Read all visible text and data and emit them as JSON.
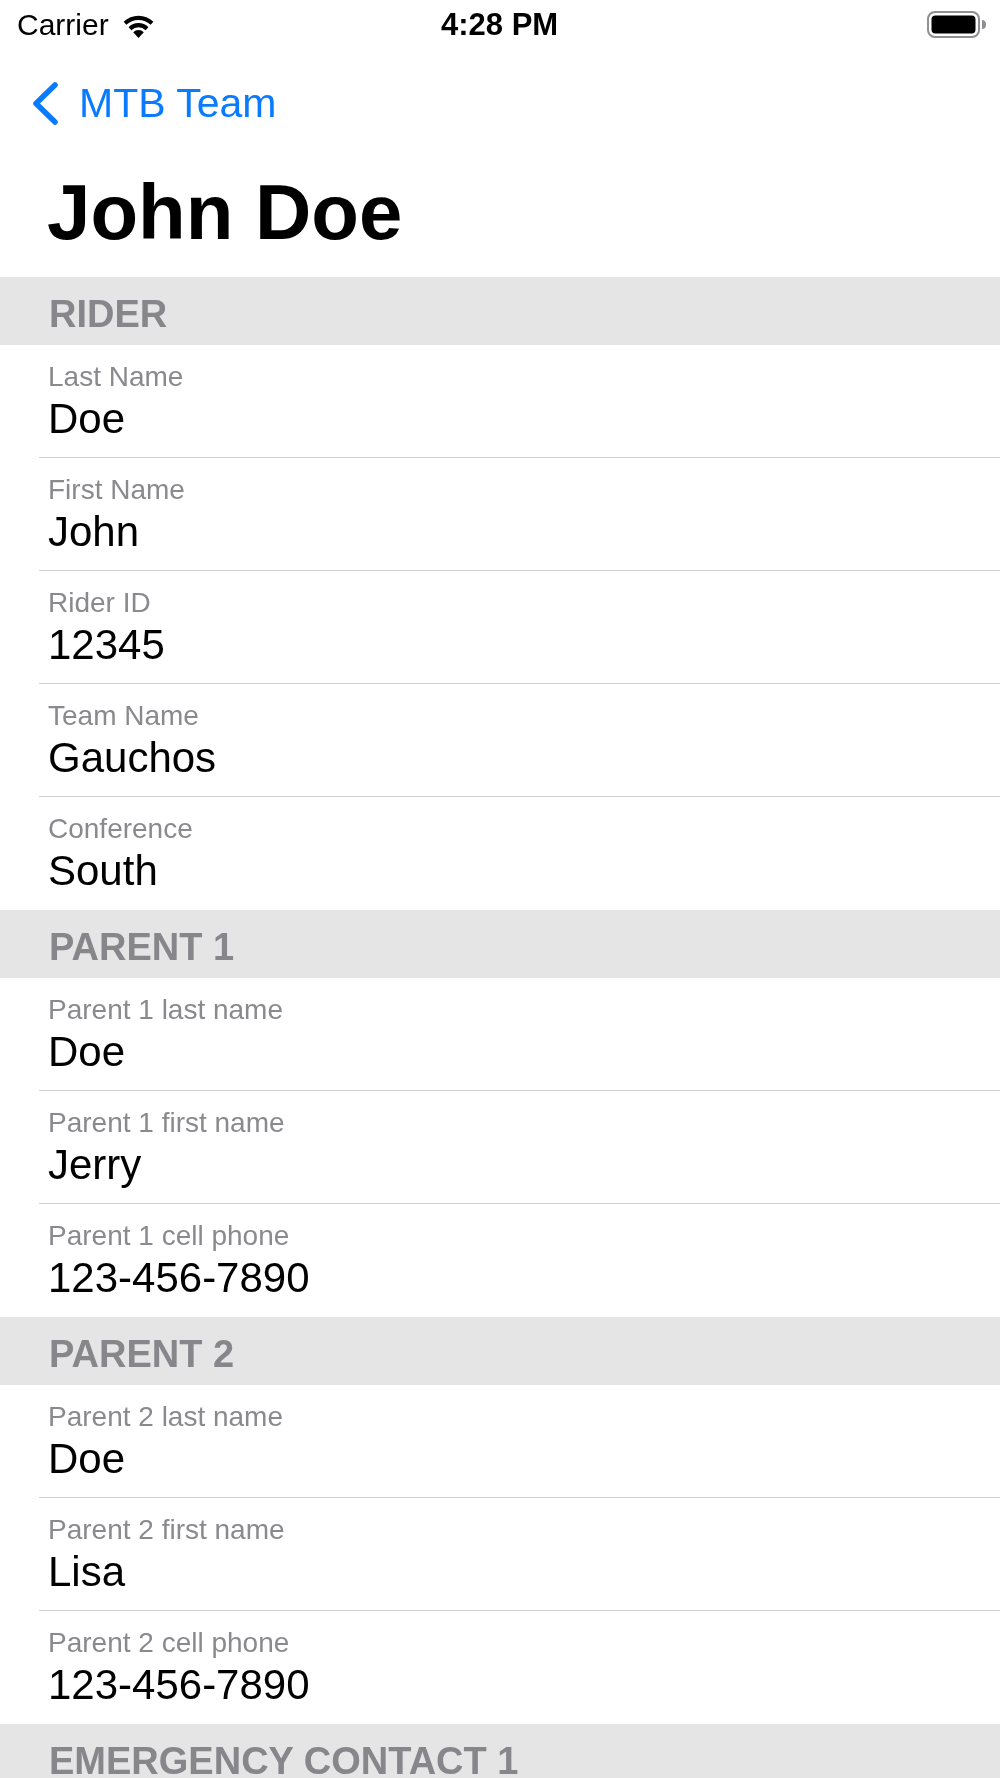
{
  "status_bar": {
    "carrier": "Carrier",
    "time": "4:28 PM"
  },
  "nav": {
    "back_label": "MTB Team",
    "title": "John Doe"
  },
  "sections": [
    {
      "header": "RIDER",
      "fields": [
        {
          "label": "Last Name",
          "value": "Doe"
        },
        {
          "label": "First Name",
          "value": "John"
        },
        {
          "label": "Rider ID",
          "value": "12345"
        },
        {
          "label": "Team Name",
          "value": "Gauchos"
        },
        {
          "label": "Conference",
          "value": "South"
        }
      ]
    },
    {
      "header": "PARENT 1",
      "fields": [
        {
          "label": "Parent 1 last name",
          "value": "Doe"
        },
        {
          "label": "Parent 1 first name",
          "value": "Jerry"
        },
        {
          "label": "Parent 1 cell phone",
          "value": "123-456-7890"
        }
      ]
    },
    {
      "header": "PARENT 2",
      "fields": [
        {
          "label": "Parent 2 last name",
          "value": "Doe"
        },
        {
          "label": "Parent 2 first name",
          "value": "Lisa"
        },
        {
          "label": "Parent 2 cell phone",
          "value": "123-456-7890"
        }
      ]
    },
    {
      "header": "EMERGENCY CONTACT 1"
    }
  ]
}
